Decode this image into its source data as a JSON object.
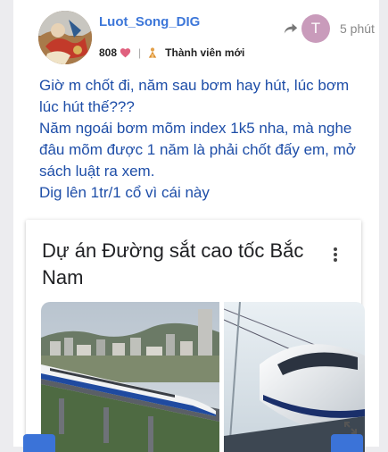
{
  "post": {
    "author": "Luot_Song_DIG",
    "likes": "808",
    "role": "Thành viên mới",
    "reply_to_initial": "T",
    "time": "5 phút",
    "body": [
      "Giờ m chốt đi, năm sau bơm hay hút, lúc bơm lúc hút thế???",
      "Năm ngoái bơm mõm index 1k5 nha, mà nghe đâu mõm được 1 năm là phải chốt đấy em, mở sách luật ra xem.",
      "Dig lên 1tr/1 cổ vì cái này"
    ]
  },
  "card": {
    "title": "Dự án Đường sắt cao tốc Bắc Nam"
  },
  "colors": {
    "username": "#3d77d9",
    "body_text": "#1e4ea8",
    "heart": "#e0607e",
    "reply_avatar": "#c99bbb",
    "fab": "#3b73d8"
  },
  "icons": {
    "heart": "heart-icon",
    "badge": "new-member-badge-icon",
    "reply": "reply-arrow-icon",
    "menu": "more-vertical-icon",
    "expand": "expand-icon"
  }
}
